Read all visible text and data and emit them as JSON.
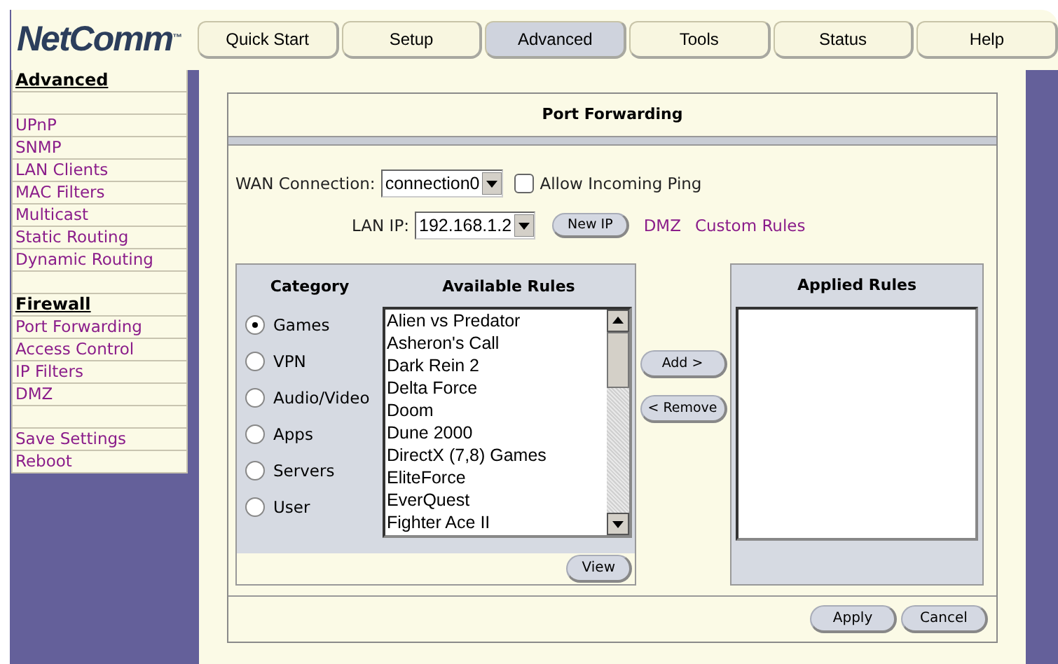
{
  "logo": "NetComm$^{™}$",
  "tabs": [
    {
      "label": "Quick Start",
      "selected": false
    },
    {
      "label": "Setup",
      "selected": false
    },
    {
      "label": "Advanced",
      "selected": true
    },
    {
      "label": "Tools",
      "selected": false
    },
    {
      "label": "Status",
      "selected": false
    },
    {
      "label": "Help",
      "selected": false
    }
  ],
  "sidebar": {
    "items": [
      {
        "kind": "heading",
        "label": "Advanced"
      },
      {
        "kind": "spacer"
      },
      {
        "kind": "link",
        "label": "UPnP"
      },
      {
        "kind": "link",
        "label": "SNMP"
      },
      {
        "kind": "link",
        "label": "LAN Clients"
      },
      {
        "kind": "link",
        "label": "MAC Filters"
      },
      {
        "kind": "link",
        "label": "Multicast"
      },
      {
        "kind": "link",
        "label": "Static Routing"
      },
      {
        "kind": "link",
        "label": "Dynamic Routing"
      },
      {
        "kind": "spacer"
      },
      {
        "kind": "heading",
        "label": "Firewall"
      },
      {
        "kind": "link",
        "label": "Port Forwarding"
      },
      {
        "kind": "link",
        "label": "Access Control"
      },
      {
        "kind": "link",
        "label": "IP Filters"
      },
      {
        "kind": "link",
        "label": "DMZ"
      },
      {
        "kind": "spacer"
      },
      {
        "kind": "link",
        "label": "Save Settings"
      },
      {
        "kind": "link",
        "label": "Reboot"
      }
    ]
  },
  "panel": {
    "title": "Port Forwarding",
    "wan": {
      "label": "WAN Connection:",
      "value": "connection0"
    },
    "ping": {
      "label": "Allow Incoming Ping",
      "checked": false
    },
    "lan": {
      "label": "LAN IP:",
      "value": "192.168.1.2"
    },
    "new_ip_button": "New IP",
    "links": [
      "DMZ",
      "Custom Rules"
    ],
    "category": {
      "heading": "Category",
      "options": [
        {
          "label": "Games",
          "selected": true
        },
        {
          "label": "VPN",
          "selected": false
        },
        {
          "label": "Audio/Video",
          "selected": false
        },
        {
          "label": "Apps",
          "selected": false
        },
        {
          "label": "Servers",
          "selected": false
        },
        {
          "label": "User",
          "selected": false
        }
      ]
    },
    "available": {
      "heading": "Available Rules",
      "items": [
        "Alien vs Predator",
        "Asheron's Call",
        "Dark Rein 2",
        "Delta Force",
        "Doom",
        "Dune 2000",
        "DirectX (7,8) Games",
        "EliteForce",
        "EverQuest",
        "Fighter Ace II"
      ],
      "view_button": "View"
    },
    "add_button": "Add >",
    "remove_button": "< Remove",
    "applied": {
      "heading": "Applied Rules"
    },
    "apply_button": "Apply",
    "cancel_button": "Cancel"
  }
}
